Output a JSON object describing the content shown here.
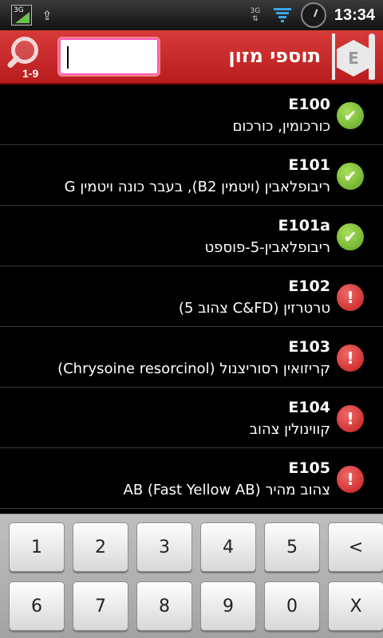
{
  "status_bar": {
    "network_badge": "3G",
    "data_label": "3G",
    "time": "13:34",
    "icons": [
      "3g-signal-icon",
      "usb-icon",
      "data-transfer-icon",
      "signal-strength-icon",
      "clock-widget-icon"
    ]
  },
  "header": {
    "title": "תוספי מזון",
    "range_label": "1-9",
    "search_value": "",
    "search_placeholder": "",
    "logo_letter": "E"
  },
  "items": [
    {
      "code": "E100",
      "desc": "כורכומין, כורכום",
      "status": "ok"
    },
    {
      "code": "E101",
      "desc": "ריבופלאבין (ויטמין B2), בעבר כונה ויטמין G",
      "status": "ok"
    },
    {
      "code": "E101a",
      "desc": "ריבופלאבין-5-פוספט",
      "status": "ok"
    },
    {
      "code": "E102",
      "desc": "טרטרזין (C&FD צהוב 5)",
      "status": "warn"
    },
    {
      "code": "E103",
      "desc": "קריזואין רסוריצנול (Chrysoine resorcinol)",
      "status": "warn"
    },
    {
      "code": "E104",
      "desc": "קווינולין צהוב",
      "status": "warn"
    },
    {
      "code": "E105",
      "desc": "צהוב מהיר AB (Fast Yellow AB)",
      "status": "warn"
    }
  ],
  "keypad": {
    "row1": [
      "1",
      "2",
      "3",
      "4",
      "5",
      "<"
    ],
    "row2": [
      "6",
      "7",
      "8",
      "9",
      "0",
      "X"
    ]
  },
  "colors": {
    "header_red": "#c92a2a",
    "ok_green": "#7cc23a",
    "warn_red": "#d92c2c"
  }
}
